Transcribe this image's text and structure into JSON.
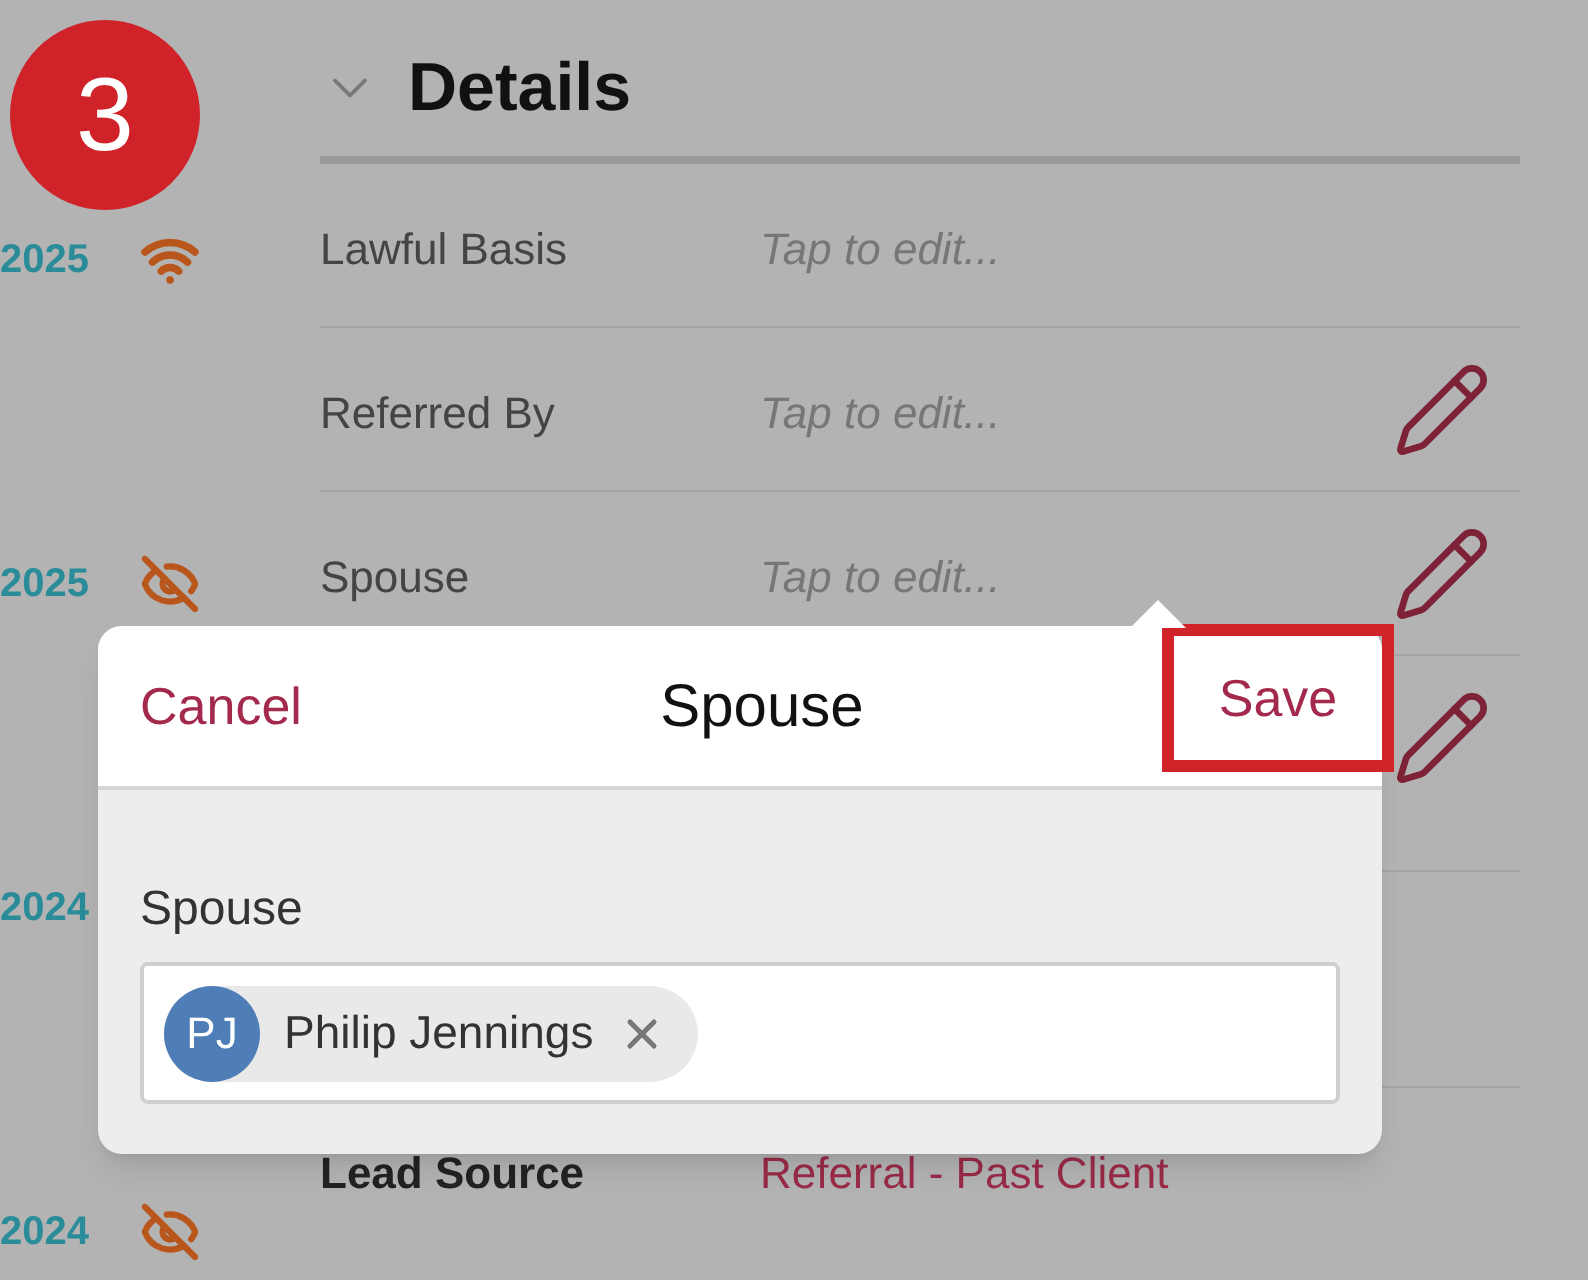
{
  "step_badge": "3",
  "timeline": [
    {
      "date": "2025",
      "kind": "signal"
    },
    {
      "date": "2025",
      "kind": "hidden"
    },
    {
      "date": "2024",
      "kind": "plain"
    },
    {
      "date": "2024",
      "kind": "hidden"
    }
  ],
  "section": {
    "title": "Details",
    "expanded": true
  },
  "fields": [
    {
      "kind": "field",
      "label": "Lawful Basis",
      "placeholder": "Tap to edit...",
      "editable": false
    },
    {
      "kind": "field",
      "label": "Referred By",
      "placeholder": "Tap to edit...",
      "editable": true
    },
    {
      "kind": "field",
      "label": "Spouse",
      "placeholder": "Tap to edit...",
      "editable": true
    },
    {
      "kind": "covered",
      "editable": true
    },
    {
      "kind": "covered",
      "editable": false
    },
    {
      "kind": "value",
      "label": "Lead Source",
      "value": "Referral - Past Client",
      "editable": false
    }
  ],
  "popover": {
    "cancel": "Cancel",
    "title": "Spouse",
    "save": "Save",
    "save_highlighted": true,
    "field_label": "Spouse",
    "chips": [
      {
        "initials": "PJ",
        "name": "Philip Jennings"
      }
    ]
  }
}
